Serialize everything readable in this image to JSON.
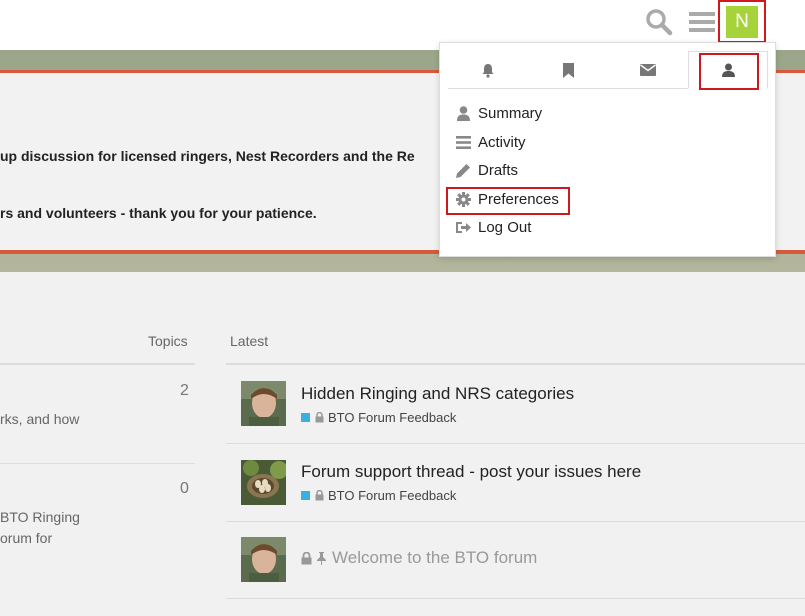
{
  "header": {
    "avatar_letter": "N"
  },
  "banner": {
    "line1": "up discussion for licensed ringers, Nest Recorders and the Re",
    "line2": "rs and volunteers - thank you for your patience."
  },
  "categories": {
    "topics_header": "Topics",
    "rows": [
      {
        "count": "2",
        "desc": [
          "rks, and how"
        ]
      },
      {
        "count": "0",
        "desc": [
          "BTO Ringing",
          "orum for"
        ]
      }
    ]
  },
  "latest": {
    "header": "Latest",
    "topics": [
      {
        "title": "Hidden Ringing and NRS categories",
        "category": "BTO Forum Feedback",
        "locked_category": true
      },
      {
        "title": "Forum support thread - post your issues here",
        "category": "BTO Forum Feedback",
        "locked_category": true
      },
      {
        "title": "Welcome to the BTO forum",
        "locked": true,
        "pinned": true
      }
    ]
  },
  "user_menu": {
    "tabs": [
      "notifications-icon",
      "bookmarks-icon",
      "messages-icon",
      "profile-icon"
    ],
    "active_tab": "profile-icon",
    "items": [
      {
        "label": "Summary",
        "icon": "user-icon"
      },
      {
        "label": "Activity",
        "icon": "list-icon"
      },
      {
        "label": "Drafts",
        "icon": "pencil-icon"
      },
      {
        "label": "Preferences",
        "icon": "gear-icon"
      },
      {
        "label": "Log Out",
        "icon": "sign-out-icon"
      }
    ]
  },
  "colors": {
    "accent_red": "#d0181f",
    "avatar_green": "#a6d33a",
    "category_blue": "#3ab0e2",
    "banner_border": "#d85a3a"
  }
}
